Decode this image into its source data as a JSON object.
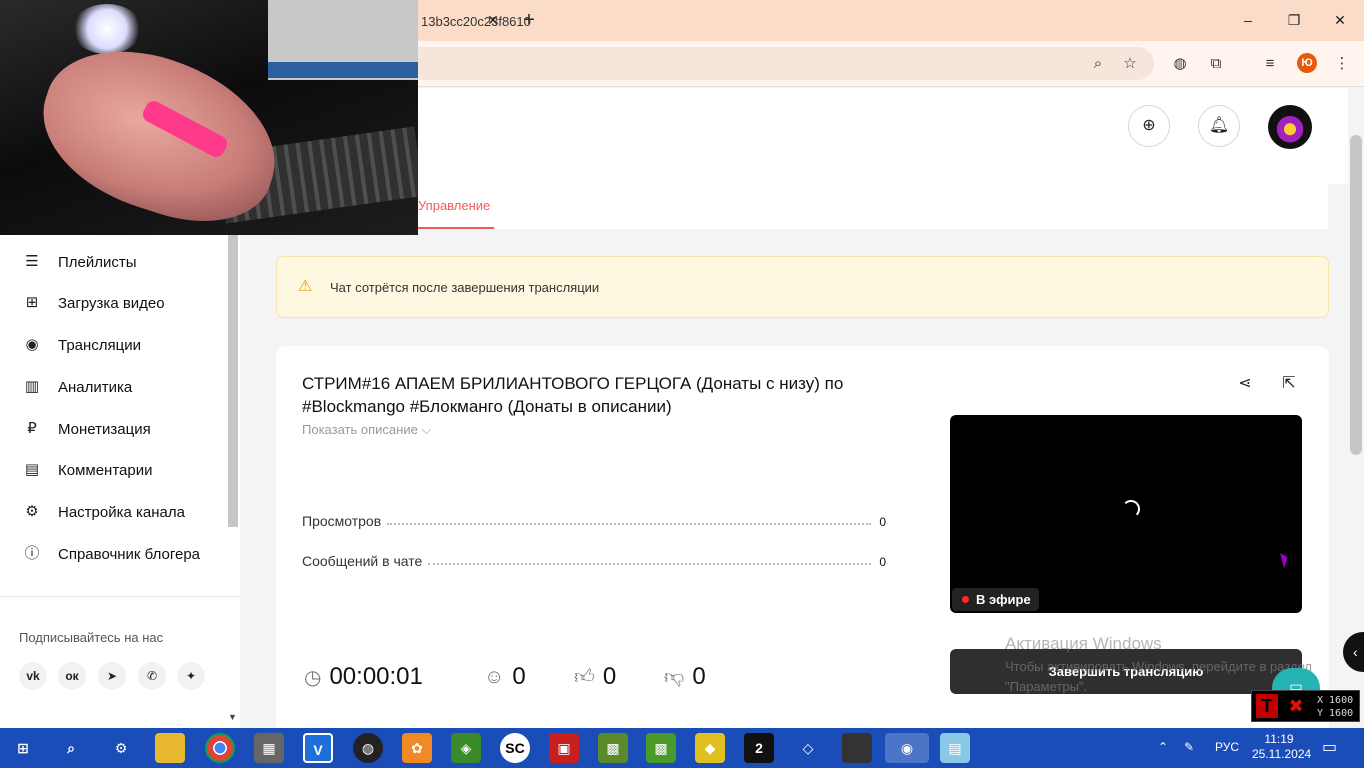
{
  "browser": {
    "url": "13b3cc20c23f8610",
    "profile_initial": "Ю",
    "tab_close": "✕",
    "new_tab": "+"
  },
  "header": {
    "tab_manage": "Управление"
  },
  "sidebar": {
    "items": [
      {
        "label": "Плейлисты",
        "icon": "playlist-icon"
      },
      {
        "label": "Загрузка видео",
        "icon": "upload-icon"
      },
      {
        "label": "Трансляции",
        "icon": "broadcast-icon"
      },
      {
        "label": "Аналитика",
        "icon": "analytics-icon"
      },
      {
        "label": "Монетизация",
        "icon": "ruble-icon"
      },
      {
        "label": "Комментарии",
        "icon": "comments-icon"
      },
      {
        "label": "Настройка канала",
        "icon": "gear-icon"
      },
      {
        "label": "Справочник блогера",
        "icon": "info-icon"
      }
    ],
    "follow_label": "Подписывайтесь на нас",
    "social": [
      "vk-icon",
      "ok-icon",
      "telegram-icon",
      "viber-icon",
      "zen-icon"
    ]
  },
  "warning": {
    "text": "Чат сотрётся после завершения трансляции"
  },
  "stream": {
    "title": "СТРИМ#16 АПАЕМ БРИЛИАНТОВОГО ГЕРЦОГА (Донаты с низу) по #Blockmango #Блокманго (Донаты в описании)",
    "show_description": "Показать описание",
    "stats": [
      {
        "label": "Просмотров",
        "value": "0"
      },
      {
        "label": "Сообщений в чате",
        "value": "0"
      }
    ],
    "live_label": "В эфире",
    "end_button": "Завершить трансляцию",
    "duration": "00:00:01",
    "viewers": "0",
    "likes": "0",
    "dislikes": "0"
  },
  "windows_activation": {
    "title": "Активация Windows",
    "subtitle": "Чтобы активировать Windows, перейдите в раздел \"Параметры\"."
  },
  "coords_overlay": {
    "x": "X 1600",
    "y": "Y 1600"
  },
  "taskbar": {
    "language": "РУС",
    "time": "11:19",
    "date": "25.11.2024"
  }
}
